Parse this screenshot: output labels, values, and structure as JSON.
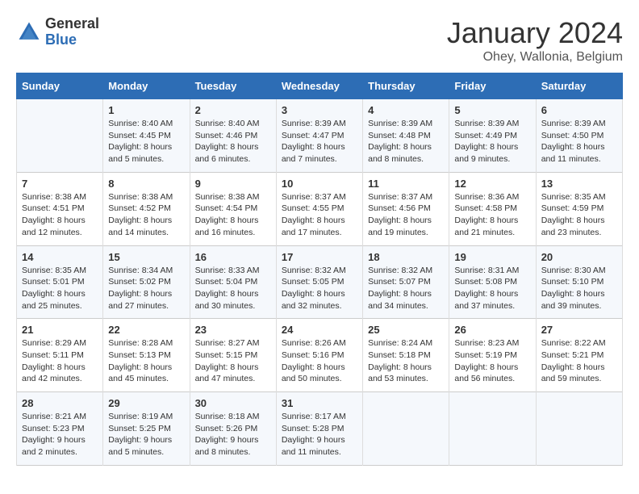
{
  "header": {
    "logo": {
      "general": "General",
      "blue": "Blue"
    },
    "title": "January 2024",
    "location": "Ohey, Wallonia, Belgium"
  },
  "calendar": {
    "days_of_week": [
      "Sunday",
      "Monday",
      "Tuesday",
      "Wednesday",
      "Thursday",
      "Friday",
      "Saturday"
    ],
    "weeks": [
      [
        {
          "day": "",
          "info": ""
        },
        {
          "day": "1",
          "info": "Sunrise: 8:40 AM\nSunset: 4:45 PM\nDaylight: 8 hours\nand 5 minutes."
        },
        {
          "day": "2",
          "info": "Sunrise: 8:40 AM\nSunset: 4:46 PM\nDaylight: 8 hours\nand 6 minutes."
        },
        {
          "day": "3",
          "info": "Sunrise: 8:39 AM\nSunset: 4:47 PM\nDaylight: 8 hours\nand 7 minutes."
        },
        {
          "day": "4",
          "info": "Sunrise: 8:39 AM\nSunset: 4:48 PM\nDaylight: 8 hours\nand 8 minutes."
        },
        {
          "day": "5",
          "info": "Sunrise: 8:39 AM\nSunset: 4:49 PM\nDaylight: 8 hours\nand 9 minutes."
        },
        {
          "day": "6",
          "info": "Sunrise: 8:39 AM\nSunset: 4:50 PM\nDaylight: 8 hours\nand 11 minutes."
        }
      ],
      [
        {
          "day": "7",
          "info": "Sunrise: 8:38 AM\nSunset: 4:51 PM\nDaylight: 8 hours\nand 12 minutes."
        },
        {
          "day": "8",
          "info": "Sunrise: 8:38 AM\nSunset: 4:52 PM\nDaylight: 8 hours\nand 14 minutes."
        },
        {
          "day": "9",
          "info": "Sunrise: 8:38 AM\nSunset: 4:54 PM\nDaylight: 8 hours\nand 16 minutes."
        },
        {
          "day": "10",
          "info": "Sunrise: 8:37 AM\nSunset: 4:55 PM\nDaylight: 8 hours\nand 17 minutes."
        },
        {
          "day": "11",
          "info": "Sunrise: 8:37 AM\nSunset: 4:56 PM\nDaylight: 8 hours\nand 19 minutes."
        },
        {
          "day": "12",
          "info": "Sunrise: 8:36 AM\nSunset: 4:58 PM\nDaylight: 8 hours\nand 21 minutes."
        },
        {
          "day": "13",
          "info": "Sunrise: 8:35 AM\nSunset: 4:59 PM\nDaylight: 8 hours\nand 23 minutes."
        }
      ],
      [
        {
          "day": "14",
          "info": "Sunrise: 8:35 AM\nSunset: 5:01 PM\nDaylight: 8 hours\nand 25 minutes."
        },
        {
          "day": "15",
          "info": "Sunrise: 8:34 AM\nSunset: 5:02 PM\nDaylight: 8 hours\nand 27 minutes."
        },
        {
          "day": "16",
          "info": "Sunrise: 8:33 AM\nSunset: 5:04 PM\nDaylight: 8 hours\nand 30 minutes."
        },
        {
          "day": "17",
          "info": "Sunrise: 8:32 AM\nSunset: 5:05 PM\nDaylight: 8 hours\nand 32 minutes."
        },
        {
          "day": "18",
          "info": "Sunrise: 8:32 AM\nSunset: 5:07 PM\nDaylight: 8 hours\nand 34 minutes."
        },
        {
          "day": "19",
          "info": "Sunrise: 8:31 AM\nSunset: 5:08 PM\nDaylight: 8 hours\nand 37 minutes."
        },
        {
          "day": "20",
          "info": "Sunrise: 8:30 AM\nSunset: 5:10 PM\nDaylight: 8 hours\nand 39 minutes."
        }
      ],
      [
        {
          "day": "21",
          "info": "Sunrise: 8:29 AM\nSunset: 5:11 PM\nDaylight: 8 hours\nand 42 minutes."
        },
        {
          "day": "22",
          "info": "Sunrise: 8:28 AM\nSunset: 5:13 PM\nDaylight: 8 hours\nand 45 minutes."
        },
        {
          "day": "23",
          "info": "Sunrise: 8:27 AM\nSunset: 5:15 PM\nDaylight: 8 hours\nand 47 minutes."
        },
        {
          "day": "24",
          "info": "Sunrise: 8:26 AM\nSunset: 5:16 PM\nDaylight: 8 hours\nand 50 minutes."
        },
        {
          "day": "25",
          "info": "Sunrise: 8:24 AM\nSunset: 5:18 PM\nDaylight: 8 hours\nand 53 minutes."
        },
        {
          "day": "26",
          "info": "Sunrise: 8:23 AM\nSunset: 5:19 PM\nDaylight: 8 hours\nand 56 minutes."
        },
        {
          "day": "27",
          "info": "Sunrise: 8:22 AM\nSunset: 5:21 PM\nDaylight: 8 hours\nand 59 minutes."
        }
      ],
      [
        {
          "day": "28",
          "info": "Sunrise: 8:21 AM\nSunset: 5:23 PM\nDaylight: 9 hours\nand 2 minutes."
        },
        {
          "day": "29",
          "info": "Sunrise: 8:19 AM\nSunset: 5:25 PM\nDaylight: 9 hours\nand 5 minutes."
        },
        {
          "day": "30",
          "info": "Sunrise: 8:18 AM\nSunset: 5:26 PM\nDaylight: 9 hours\nand 8 minutes."
        },
        {
          "day": "31",
          "info": "Sunrise: 8:17 AM\nSunset: 5:28 PM\nDaylight: 9 hours\nand 11 minutes."
        },
        {
          "day": "",
          "info": ""
        },
        {
          "day": "",
          "info": ""
        },
        {
          "day": "",
          "info": ""
        }
      ]
    ]
  }
}
